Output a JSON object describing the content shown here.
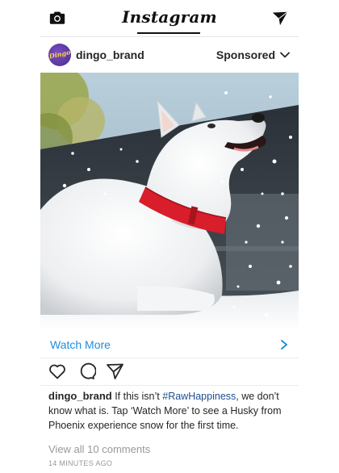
{
  "app": {
    "title": "Instagram"
  },
  "topbar": {
    "camera_icon": "camera-icon",
    "send_icon": "paper-plane-icon"
  },
  "post": {
    "avatar_text": "Dingo",
    "username": "dingo_brand",
    "sponsored_label": "Sponsored",
    "watch_more_label": "Watch More",
    "caption": {
      "username": "dingo_brand",
      "text_before": " If this isn’t ",
      "hashtag": "#RawHappiness",
      "text_after": ", we don’t know what is. Tap ‘Watch More’ to see a Husky from Phoenix experience snow for the first time."
    },
    "view_comments": "View all 10 comments",
    "timestamp": "14 MINUTES AGO",
    "colors": {
      "link_blue": "#1e8fe0",
      "hashtag_blue": "#1e4d91",
      "collar_red": "#d81e2a"
    }
  }
}
